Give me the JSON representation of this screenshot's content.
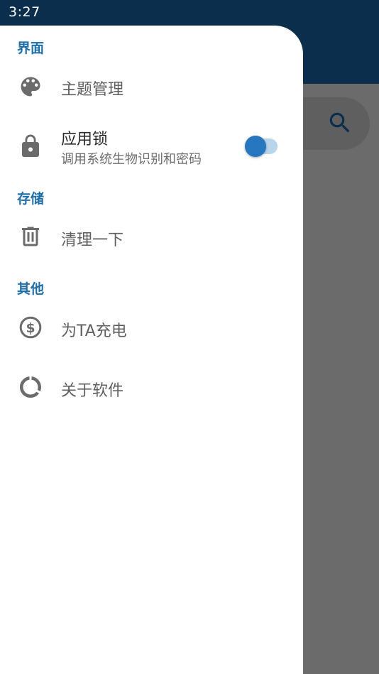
{
  "status_bar": {
    "time": "3:27"
  },
  "background_app": {
    "search_icon": "search-icon"
  },
  "drawer": {
    "sections": [
      {
        "header": "界面",
        "items": [
          {
            "label": "主题管理",
            "icon": "palette-icon"
          },
          {
            "label": "应用锁",
            "subtitle": "调用系统生物识别和密码",
            "icon": "lock-icon",
            "toggle": true
          }
        ]
      },
      {
        "header": "存储",
        "items": [
          {
            "label": "清理一下",
            "icon": "trash-icon"
          }
        ]
      },
      {
        "header": "其他",
        "items": [
          {
            "label": "为TA充电",
            "icon": "coin-icon"
          },
          {
            "label": "关于软件",
            "icon": "about-icon"
          }
        ]
      }
    ]
  },
  "colors": {
    "accent": "#1e6fa8",
    "toggle_on": "#2776c0",
    "status_bar": "#0b2e4d",
    "scrim": "#6b6b6b"
  }
}
